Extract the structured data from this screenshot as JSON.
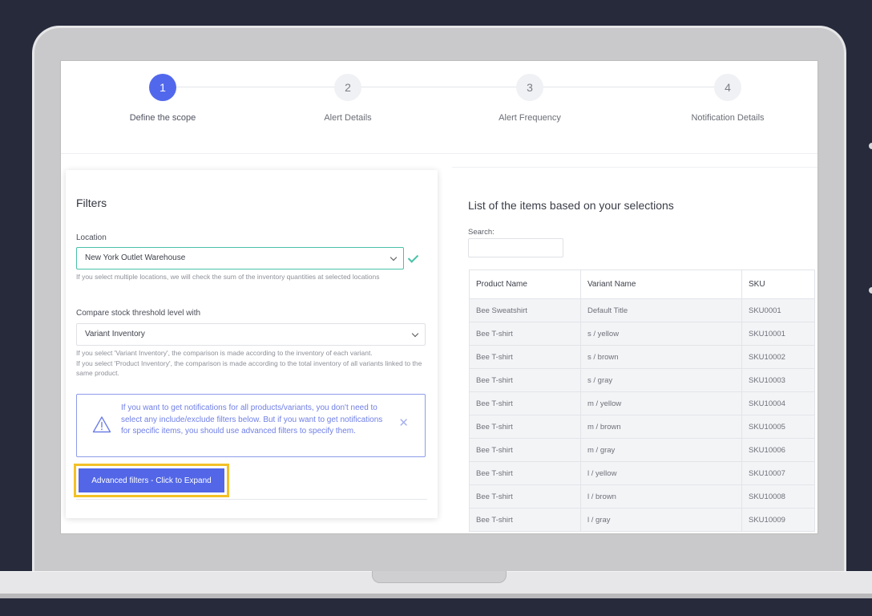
{
  "stepper": {
    "steps": [
      {
        "number": "1",
        "label": "Define the scope",
        "active": true
      },
      {
        "number": "2",
        "label": "Alert Details",
        "active": false
      },
      {
        "number": "3",
        "label": "Alert Frequency",
        "active": false
      },
      {
        "number": "4",
        "label": "Notification Details",
        "active": false
      }
    ]
  },
  "filters": {
    "title": "Filters",
    "location_label": "Location",
    "location_value": "New York Outlet Warehouse",
    "location_help": "If you select multiple locations, we will check the sum of the inventory quantities at selected locations",
    "compare_label": "Compare stock threshold level with",
    "compare_value": "Variant Inventory",
    "compare_help_1": "If you select 'Variant Inventory', the comparison is made according to the inventory of each variant.",
    "compare_help_2": "If you select 'Product Inventory', the comparison is made according to the total inventory of all variants linked to the same product.",
    "info_text": "If you want to get notifications for all products/variants, you don't need to select any include/exclude filters below. But if you want to get notifications for specific items, you should use advanced filters to specify them.",
    "advanced_button": "Advanced filters - Click to Expand"
  },
  "list": {
    "title": "List of the items based on your selections",
    "search_label": "Search:",
    "search_value": "",
    "columns": [
      "Product Name",
      "Variant Name",
      "SKU"
    ],
    "rows": [
      [
        "Bee Sweatshirt",
        "Default Title",
        "SKU0001"
      ],
      [
        "Bee T-shirt",
        "s / yellow",
        "SKU10001"
      ],
      [
        "Bee T-shirt",
        "s / brown",
        "SKU10002"
      ],
      [
        "Bee T-shirt",
        "s / gray",
        "SKU10003"
      ],
      [
        "Bee T-shirt",
        "m / yellow",
        "SKU10004"
      ],
      [
        "Bee T-shirt",
        "m / brown",
        "SKU10005"
      ],
      [
        "Bee T-shirt",
        "m / gray",
        "SKU10006"
      ],
      [
        "Bee T-shirt",
        "l / yellow",
        "SKU10007"
      ],
      [
        "Bee T-shirt",
        "l / brown",
        "SKU10008"
      ],
      [
        "Bee T-shirt",
        "l / gray",
        "SKU10009"
      ]
    ]
  },
  "colors": {
    "accent": "#5268ec",
    "button": "#5266e7",
    "highlight": "#f3c127",
    "valid": "#49c1a7",
    "info": "#6f7fe6"
  },
  "icons": {
    "valid": "check-icon",
    "info": "warning-triangle-icon",
    "dismiss": "close-icon",
    "dropdown": "chevron-down-icon"
  }
}
